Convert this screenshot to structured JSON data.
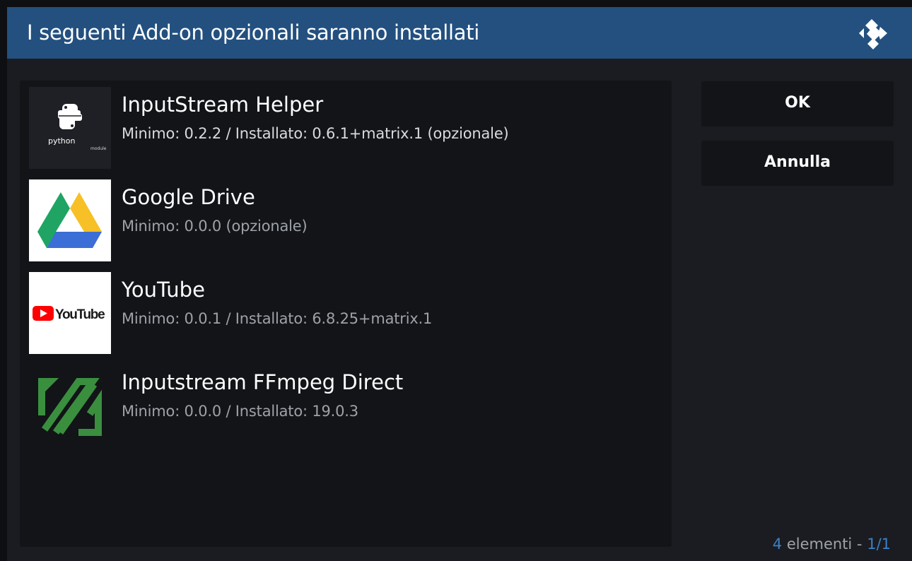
{
  "dialog": {
    "title": "I seguenti Add-on opzionali saranno installati"
  },
  "addons": [
    {
      "name": "InputStream Helper",
      "details": "Minimo: 0.2.2 / Installato: 0.6.1+matrix.1  (opzionale)",
      "icon": "python-module-icon",
      "icon_text": "python",
      "icon_subtext": "module"
    },
    {
      "name": "Google Drive",
      "details": "Minimo: 0.0.0  (opzionale)",
      "icon": "google-drive-icon"
    },
    {
      "name": "YouTube",
      "details": "Minimo: 0.0.1 / Installato: 6.8.25+matrix.1",
      "icon": "youtube-icon",
      "icon_text": "YouTube"
    },
    {
      "name": "Inputstream FFmpeg Direct",
      "details": "Minimo: 0.0.0 / Installato: 19.0.3",
      "icon": "ffmpeg-icon"
    }
  ],
  "buttons": {
    "ok": "OK",
    "cancel": "Annulla"
  },
  "footer": {
    "count": "4",
    "count_label": " elementi - ",
    "page": "1/1"
  },
  "colors": {
    "header": "#23507f",
    "accent": "#3e7fc6",
    "ffmpeg_green": "#3a8f3f",
    "youtube_red": "#ff0000"
  }
}
